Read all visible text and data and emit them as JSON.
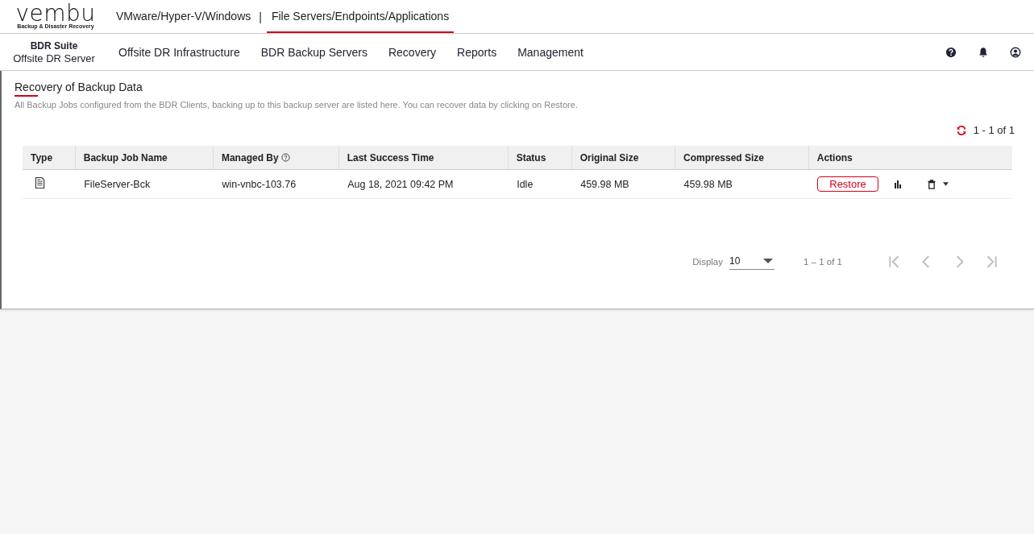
{
  "logo": {
    "text": "vembu",
    "tagline": "Backup & Disaster Recovery"
  },
  "top_tabs": [
    {
      "label": "VMware/Hyper-V/Windows",
      "selected": false
    },
    {
      "label": "File Servers/Endpoints/Applications",
      "selected": true
    }
  ],
  "top_separator": "|",
  "product": {
    "suite": "BDR Suite",
    "name": "Offsite DR Server"
  },
  "nav": [
    "Offsite DR Infrastructure",
    "BDR Backup Servers",
    "Recovery",
    "Reports",
    "Management"
  ],
  "page": {
    "title": "Recovery of Backup Data",
    "description": "All Backup Jobs configured from the BDR Clients, backing up to this backup server are listed here. You can recover data by clicking on Restore.",
    "range": "1 - 1 of 1"
  },
  "table": {
    "columns": [
      "Type",
      "Backup Job Name",
      "Managed By",
      "Last Success Time",
      "Status",
      "Original Size",
      "Compressed Size",
      "Actions"
    ],
    "rows": [
      {
        "name": "FileServer-Bck",
        "managed_by": "win-vnbc-103.76",
        "last_success": "Aug 18, 2021 09:42 PM",
        "status": "Idle",
        "original_size": "459.98 MB",
        "compressed_size": "459.98 MB",
        "action": "Restore"
      }
    ]
  },
  "paginator": {
    "label": "Display",
    "page_size": "10",
    "range": "1 – 1 of 1",
    "first_disabled": true,
    "prev_disabled": true,
    "next_disabled": true,
    "last_disabled": true
  }
}
